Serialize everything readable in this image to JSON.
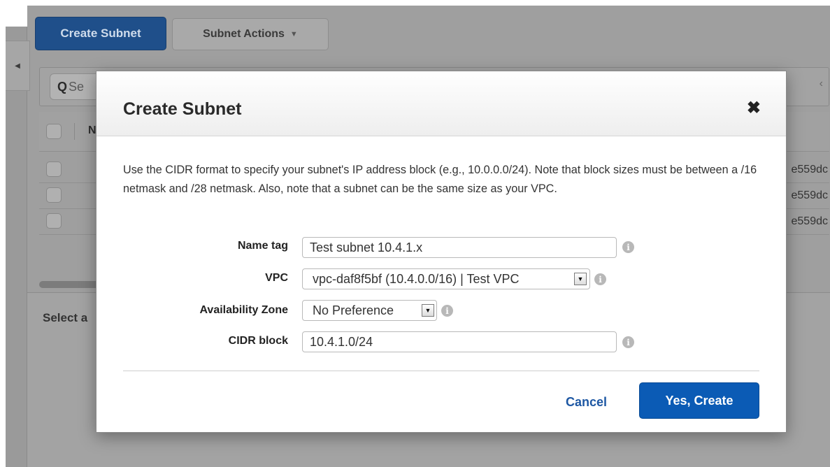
{
  "toolbar": {
    "create_label": "Create Subnet",
    "actions_label": "Subnet Actions"
  },
  "search": {
    "placeholder_visible": "Se"
  },
  "table": {
    "header_first_col": "N",
    "row_ids": [
      "e559dc",
      "e559dc",
      "e559dc"
    ]
  },
  "detail": {
    "select_text": "Select a"
  },
  "modal": {
    "title": "Create Subnet",
    "description": "Use the CIDR format to specify your subnet's IP address block (e.g., 10.0.0.0/24). Note that block sizes must be between a /16 netmask and /28 netmask. Also, note that a subnet can be the same size as your VPC.",
    "fields": {
      "name_tag": {
        "label": "Name tag",
        "value": "Test subnet 10.4.1.x"
      },
      "vpc": {
        "label": "VPC",
        "value": "vpc-daf8f5bf (10.4.0.0/16) | Test VPC"
      },
      "availability_zone": {
        "label": "Availability Zone",
        "value": "No Preference"
      },
      "cidr_block": {
        "label": "CIDR block",
        "value": "10.4.1.0/24"
      }
    },
    "cancel_label": "Cancel",
    "confirm_label": "Yes, Create"
  }
}
